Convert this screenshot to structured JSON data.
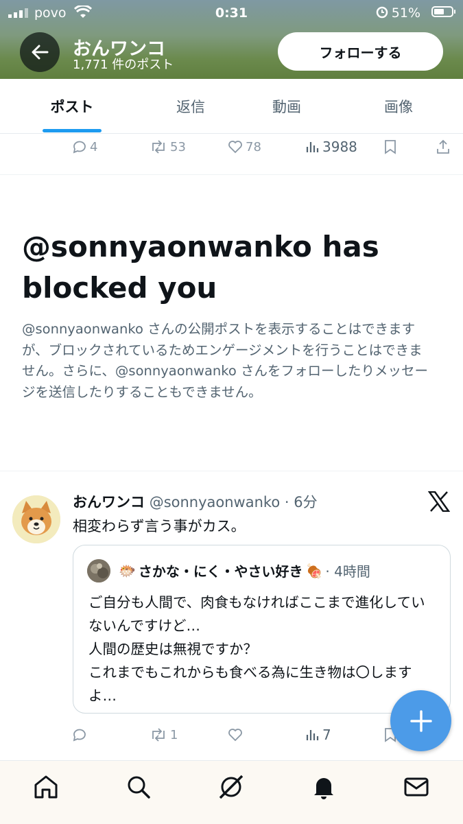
{
  "status_bar": {
    "carrier": "povo",
    "time": "0:31",
    "battery": "51%"
  },
  "header": {
    "name": "おんワンコ",
    "post_count": "1,771 件のポスト",
    "follow_label": "フォローする"
  },
  "tabs": [
    {
      "label": "ポスト",
      "active": true
    },
    {
      "label": "返信",
      "active": false
    },
    {
      "label": "動画",
      "active": false
    },
    {
      "label": "画像",
      "active": false
    }
  ],
  "prev_post_actions": {
    "replies": "4",
    "reposts": "53",
    "likes": "78",
    "views": "3988"
  },
  "blocked": {
    "title": "@sonnyaonwanko has blocked you",
    "body": "@sonnyaonwanko さんの公開ポストを表示することはできますが、ブロックされているためエンゲージメントを行うことはできません。さらに、@sonnyaonwanko さんをフォローしたりメッセージを送信したりすることもできません。"
  },
  "tweet": {
    "name": "おんワンコ",
    "handle": "@sonnyaonwanko",
    "time": "· 6分",
    "text": "相変わらず言う事がカス。",
    "quote": {
      "name_emoji_1": "🐡",
      "name": "さかな・にく・やさい好き",
      "name_emoji_2": "🍖",
      "time": "· 4時間",
      "text": "ご自分も人間で、肉食もなければここまで進化していないんですけど…\n人間の歴史は無視ですか？\nこれまでもこれからも食べる為に生き物は〇しますよ…"
    },
    "actions": {
      "replies": "",
      "reposts": "1",
      "likes": "",
      "views": "7"
    }
  },
  "colors": {
    "accent": "#1d9bf0",
    "fab": "#4c9be8",
    "muted": "#536471"
  },
  "icons": [
    "signal-icon",
    "wifi-icon",
    "alarm-icon",
    "battery-icon",
    "back-arrow-icon",
    "reply-icon",
    "repost-icon",
    "like-icon",
    "views-icon",
    "bookmark-icon",
    "share-icon",
    "x-logo-icon",
    "compose-plus-icon",
    "home-icon",
    "search-icon",
    "grok-icon",
    "notifications-icon",
    "messages-icon"
  ]
}
